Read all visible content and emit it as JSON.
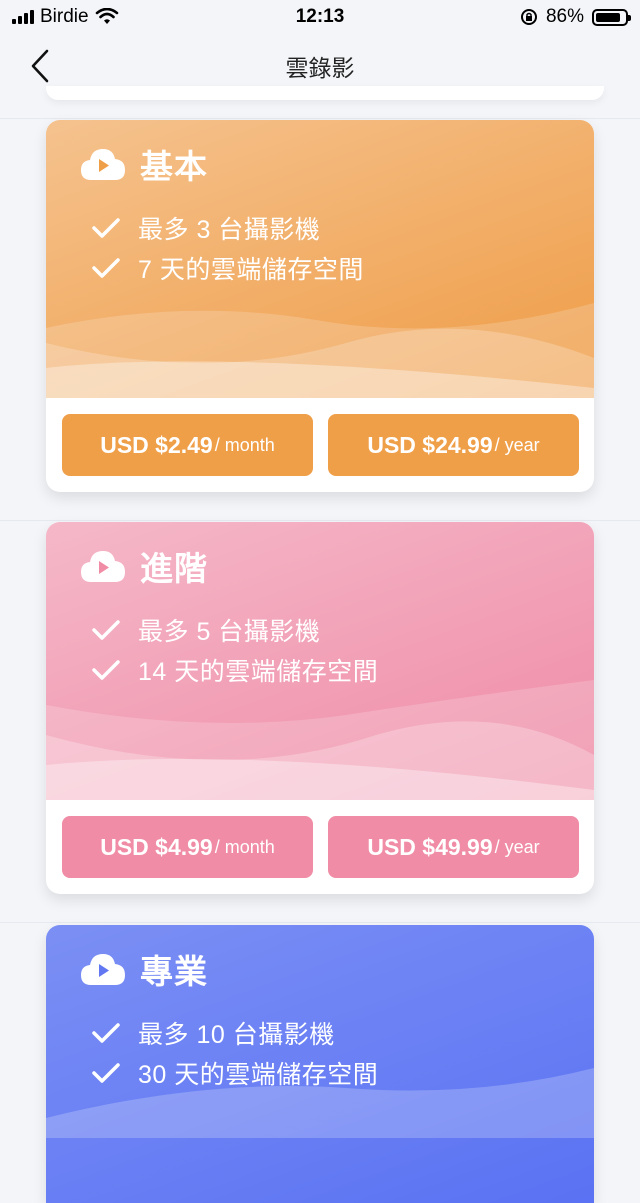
{
  "status_bar": {
    "carrier": "Birdie",
    "time": "12:13",
    "battery": "86%",
    "battery_level": 0.86
  },
  "nav": {
    "title": "雲錄影",
    "back_icon": "chevron-left-icon"
  },
  "plans": [
    {
      "name": "基本",
      "features": [
        "最多 3 台攝影機",
        "7 天的雲端儲存空間"
      ],
      "monthly": {
        "amount": "USD $2.49",
        "period": "/ month"
      },
      "yearly": {
        "amount": "USD $24.99",
        "period": "/ year"
      },
      "colors": {
        "top": "#f5c28e",
        "bottom": "#ef9c45",
        "button": "#f09f49"
      }
    },
    {
      "name": "進階",
      "features": [
        "最多 5 台攝影機",
        "14 天的雲端儲存空間"
      ],
      "monthly": {
        "amount": "USD $4.99",
        "period": "/ month"
      },
      "yearly": {
        "amount": "USD $49.99",
        "period": "/ year"
      },
      "colors": {
        "top": "#f5b8c9",
        "bottom": "#ef8aa5",
        "button": "#f08ca5"
      }
    },
    {
      "name": "專業",
      "features": [
        "最多 10 台攝影機",
        "30 天的雲端儲存空間"
      ],
      "colors": {
        "top": "#7b8ff4",
        "bottom": "#5a72f3",
        "button": "#6178f2"
      }
    }
  ]
}
